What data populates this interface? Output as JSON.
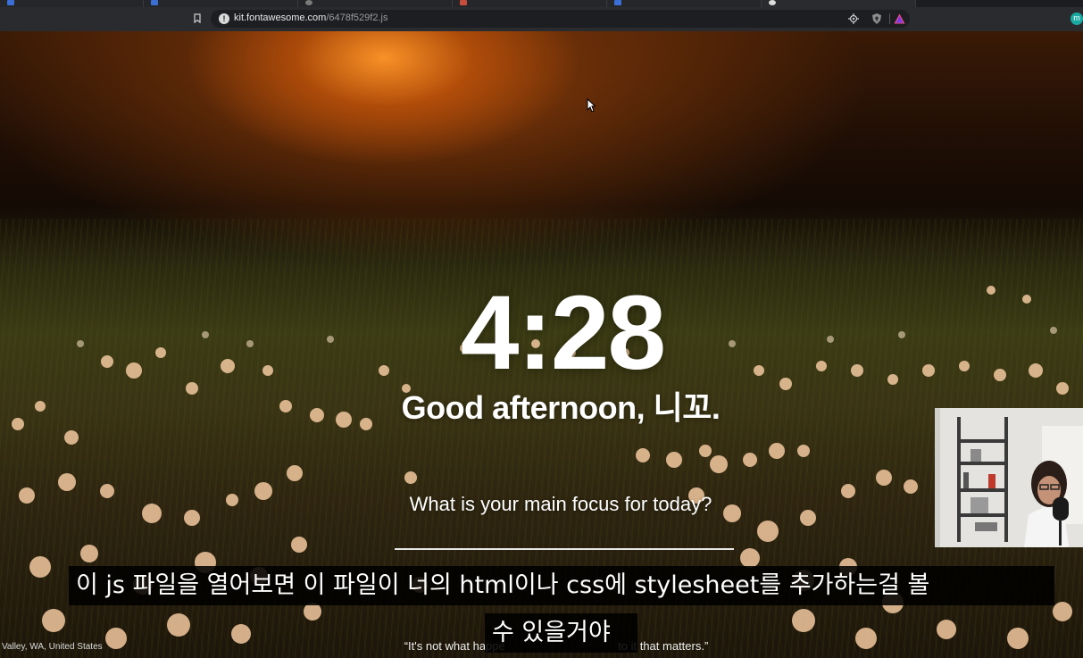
{
  "browser": {
    "url_host": "kit.fontawesome.com",
    "url_path": "/6478f529f2.js",
    "profile_initial": "m"
  },
  "momentum": {
    "time": "4:28",
    "greeting": "Good afternoon, 니꼬.",
    "focus_prompt": "What is your main focus for today?",
    "focus_value": "",
    "location": "Valley, WA, United States",
    "quote_visible": "“It's not what happe                                   to it that matters.”"
  },
  "subtitles": {
    "line1": "이 js 파일을 열어보면 이 파일이 너의 html이나 css에 stylesheet를 추가하는걸 볼",
    "line2": "수 있을거야"
  },
  "colors": {
    "chrome_bg": "#2a2b2e",
    "omnibox_bg": "#1d1e21",
    "profile": "#1aa8a0"
  },
  "icons": [
    "bookmark-icon",
    "info-icon",
    "location-icon",
    "brave-shield-icon",
    "brave-rewards-icon",
    "profile-icon",
    "cursor-icon"
  ]
}
